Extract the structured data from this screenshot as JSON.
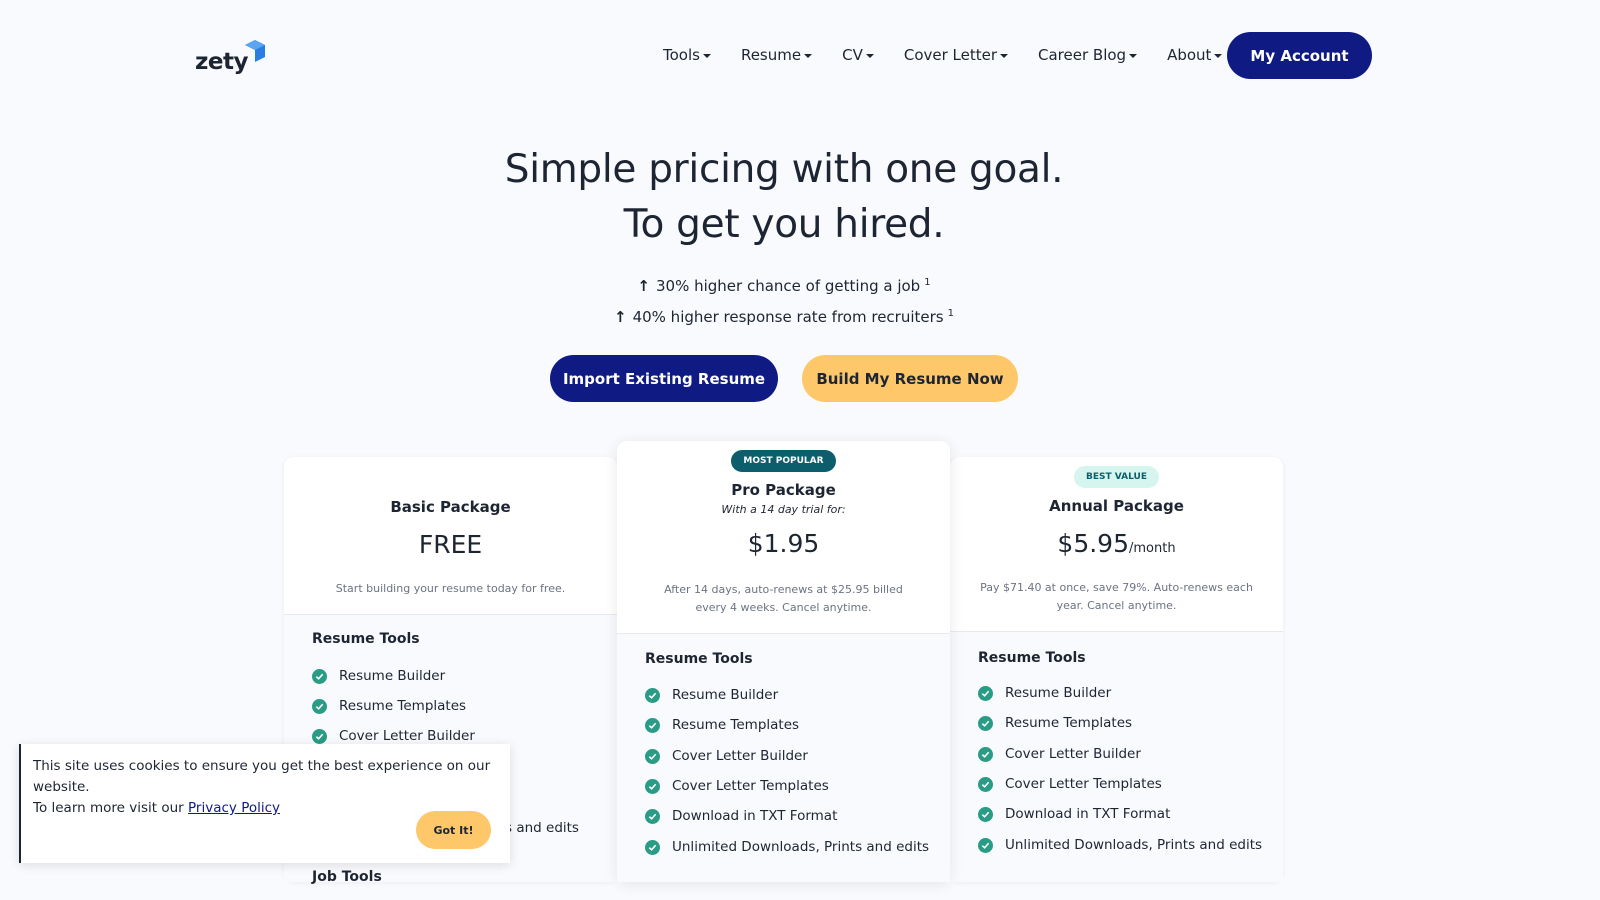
{
  "header": {
    "logo_text": "zety",
    "nav": [
      "Tools",
      "Resume",
      "CV",
      "Cover Letter",
      "Career Blog",
      "About"
    ],
    "account_label": "My Account"
  },
  "hero": {
    "title_line1": "Simple pricing with one goal.",
    "title_line2": "To get you hired.",
    "stat1": "30% higher chance of getting a job",
    "stat2": "40% higher response rate from recruiters",
    "footnote": "1",
    "import_label": "Import Existing Resume",
    "build_label": "Build My Resume Now"
  },
  "plans": {
    "basic": {
      "name": "Basic Package",
      "price": "FREE",
      "note": "Start building your resume today for free.",
      "section": "Resume Tools",
      "features": [
        "Resume Builder",
        "Resume Templates",
        "Cover Letter Builder"
      ],
      "partial_feature": "s and edits",
      "section2": "Job Tools"
    },
    "pro": {
      "badge": "MOST POPULAR",
      "name": "Pro Package",
      "trial": "With a 14 day trial for:",
      "price": "$1.95",
      "note_line1": "After 14 days, auto-renews at $25.95 billed",
      "note_line2": "every 4 weeks. Cancel anytime.",
      "section": "Resume Tools",
      "features": [
        "Resume Builder",
        "Resume Templates",
        "Cover Letter Builder",
        "Cover Letter Templates",
        "Download in TXT Format",
        "Unlimited Downloads, Prints and edits"
      ]
    },
    "annual": {
      "badge": "BEST VALUE",
      "name": "Annual Package",
      "price": "$5.95",
      "price_unit": "/month",
      "note_line1": "Pay $71.40 at once, save 79%. Auto-renews each",
      "note_line2": "year. Cancel anytime.",
      "section": "Resume Tools",
      "features": [
        "Resume Builder",
        "Resume Templates",
        "Cover Letter Builder",
        "Cover Letter Templates",
        "Download in TXT Format",
        "Unlimited Downloads, Prints and edits"
      ]
    }
  },
  "cookie": {
    "line1": "This site uses cookies to ensure you get the best experience on our website.",
    "line2_prefix": "To learn more visit our ",
    "link": "Privacy Policy",
    "button": "Got It!"
  },
  "colors": {
    "primary": "#0f1a82",
    "accent": "#fdc76a",
    "check": "#2a9c86",
    "badge_popular": "#0c5e6d",
    "badge_value": "#d6f5ee"
  }
}
